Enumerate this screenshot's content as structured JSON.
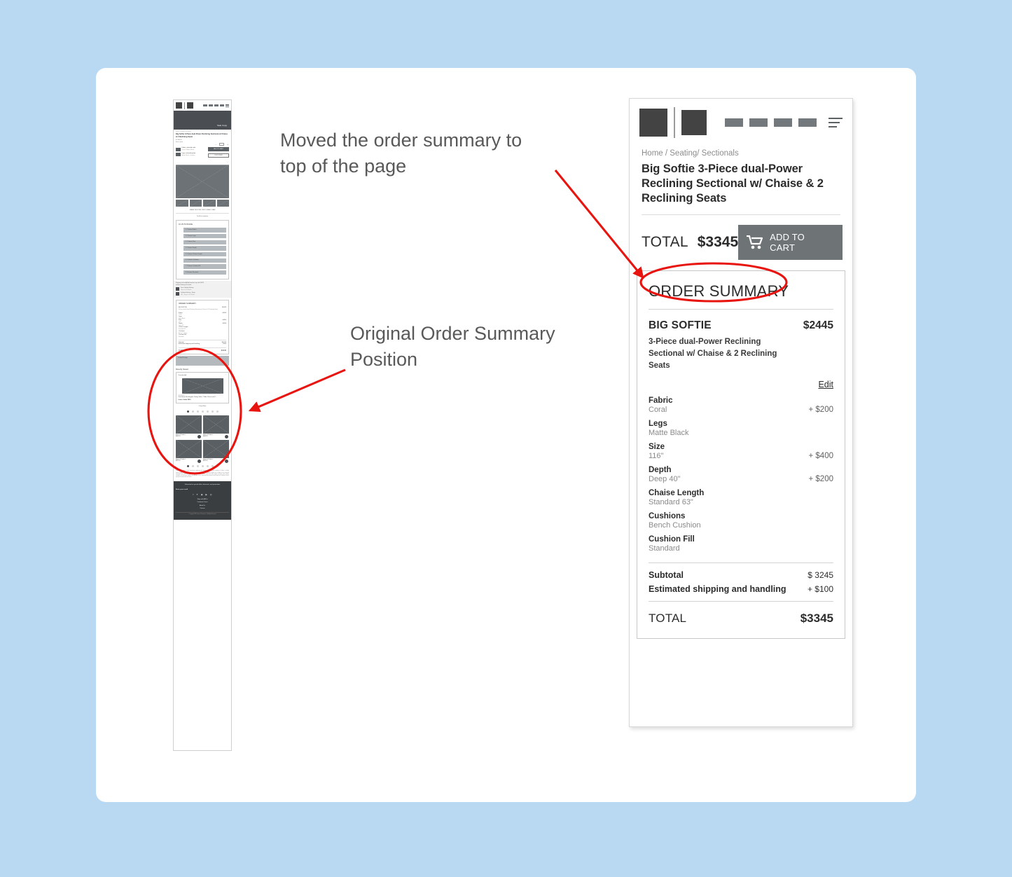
{
  "annotations": {
    "note_moved": "Moved the order summary to top of the page",
    "note_original": "Original Order Summary Position",
    "accent_color": "#e8140f"
  },
  "canvas": {
    "background": "#b9d9f2",
    "card_background": "#ffffff"
  },
  "phone": {
    "nav": {
      "logo": "logo-block",
      "logo_secondary": "logo-block-2",
      "items": [
        "nav-item-1",
        "nav-item-2",
        "nav-item-3",
        "nav-item-4"
      ],
      "menu_icon": "hamburger-icon"
    },
    "breadcrumb": "Home / Seating/ Sectionals",
    "title": "Big Softie 3-Piece dual-Power Reclining Sectional w/ Chaise & 2 Reclining Seats",
    "total_label": "TOTAL",
    "total_value": "$3345",
    "add_to_cart": "ADD TO CART",
    "order_summary": {
      "heading": "ORDER SUMMARY",
      "product_name": "BIG SOFTIE",
      "product_price": "$2445",
      "product_desc": "3-Piece dual-Power Reclining Sectional w/ Chaise & 2 Reclining Seats",
      "edit_label": "Edit",
      "options": [
        {
          "name": "Fabric",
          "value": "Coral",
          "add": "+ $200"
        },
        {
          "name": "Legs",
          "value": "Matte Black",
          "add": ""
        },
        {
          "name": "Size",
          "value": "116\"",
          "add": "+ $400"
        },
        {
          "name": "Depth",
          "value": "Deep 40\"",
          "add": "+ $200"
        },
        {
          "name": "Chaise Length",
          "value": "Standard 63\"",
          "add": ""
        },
        {
          "name": "Cushions",
          "value": "Bench Cushion",
          "add": ""
        },
        {
          "name": "Cushion Fill",
          "value": "Standard",
          "add": ""
        }
      ],
      "subtotal_label": "Subtotal",
      "subtotal_value": "$ 3245",
      "shipping_label": "Estimated shipping and handling",
      "shipping_value": "+ $100",
      "total_label": "TOTAL",
      "total_value": "$3345"
    }
  },
  "wireframe": {
    "hero_caption": "Sale Copy",
    "breadcrumb": "Home / Seating/ Sectionals",
    "title": "Big Softie 3-Piece dual-Power Reclining Sectional w/ Chaise & 2 Reclining Seats",
    "price": "$ 2,800.00",
    "price_note": "Item in stock",
    "qty": "1",
    "opt_fabric": "Fabric: selected color",
    "opt_fabric_sub": "Coral / Matte Black",
    "opt_legs": "Legs: selected option",
    "opt_legs_sub": "Matte Black / leather",
    "btn_add": "ADD TO CART",
    "btn_customize": "CUSTOMIZE",
    "share_line": "SHARE THIS ITEM: PRINT / EMAIL / SAVE",
    "scroll_hint": "Scroll to customize",
    "customize_heading": "CUSTOMIZE",
    "customize_steps": [
      "1. Choose Fabric",
      "2. Choose Legs",
      "3. Choose Size",
      "4. Choose Depth",
      "5. Choose Chaise Length",
      "6. Choose Cushions",
      "7. Choose Cushion Fill",
      "8. Review Sectional"
    ],
    "ship_line1": "Shipping and availability based on zip code 90210",
    "ship_line2": "In-Stock Delivery 4-6 weeks",
    "ship_opt1": "Free Curbside Delivery",
    "ship_opt1_sub": "Ships in 4-6 Weeks",
    "ship_opt2": "In-Home Delivery + Setup",
    "ship_opt2_sub": "$99 - Ships in 4-6 Weeks",
    "order_summary_heading": "ORDER SUMMARY",
    "os_product": "BIG SOFTIE",
    "os_price": "$2445",
    "os_desc": "3-Piece dual-Power Reclining Sectional w/ Chaise & 2 Reclining Seats",
    "os_options": [
      {
        "name": "Fabric",
        "value": "Coral",
        "add": "+$200"
      },
      {
        "name": "Legs",
        "value": "Matte Black",
        "add": ""
      },
      {
        "name": "Size",
        "value": "116\"",
        "add": "+$400"
      },
      {
        "name": "Depth",
        "value": "Deep 40\"",
        "add": "+$200"
      },
      {
        "name": "Chaise Length",
        "value": "Standard 63\"",
        "add": ""
      },
      {
        "name": "Cushions",
        "value": "Bench Cushion",
        "add": ""
      },
      {
        "name": "Cushion Fill",
        "value": "Standard",
        "add": ""
      }
    ],
    "os_subtotal": "Subtotal",
    "os_subtotal_val": "$3,245",
    "os_shipping": "Estimated shipping and handling",
    "os_shipping_val": "$100",
    "os_total": "TOTAL",
    "os_total_val": "$3345",
    "cta_band": "Limited Design",
    "recently_viewed": "Recently Viewed",
    "rv_badge": "Overstocked",
    "rv_sku": "SE-924078",
    "rv_title": "Oak Grove Rectangular Dining Table, 2 Side Chairs and 2...",
    "rv_price": "Lower Grade $950",
    "carousel_label": "Living Room",
    "grid": [
      {
        "title": "Name of Product...",
        "price": "$449.99"
      },
      {
        "title": "Name of Product...",
        "price": "$449.99"
      },
      {
        "title": "Name of Product...",
        "price": "$619.99"
      },
      {
        "title": "Name of Product...",
        "price": "$619.99"
      }
    ],
    "footer_sub": "Subscribe for special offers, discounts, and promotions",
    "footer_email_label": "Enter your email",
    "footer_social": [
      "f",
      "t",
      "p",
      "y",
      "i"
    ],
    "footer_links": [
      "Shop with ARF ▾",
      "Customer Care ▾",
      "About Us",
      "Careers"
    ],
    "footer_copy": "© Copyright 2021 Furniture Showroom Co. All Rights Reserved."
  }
}
